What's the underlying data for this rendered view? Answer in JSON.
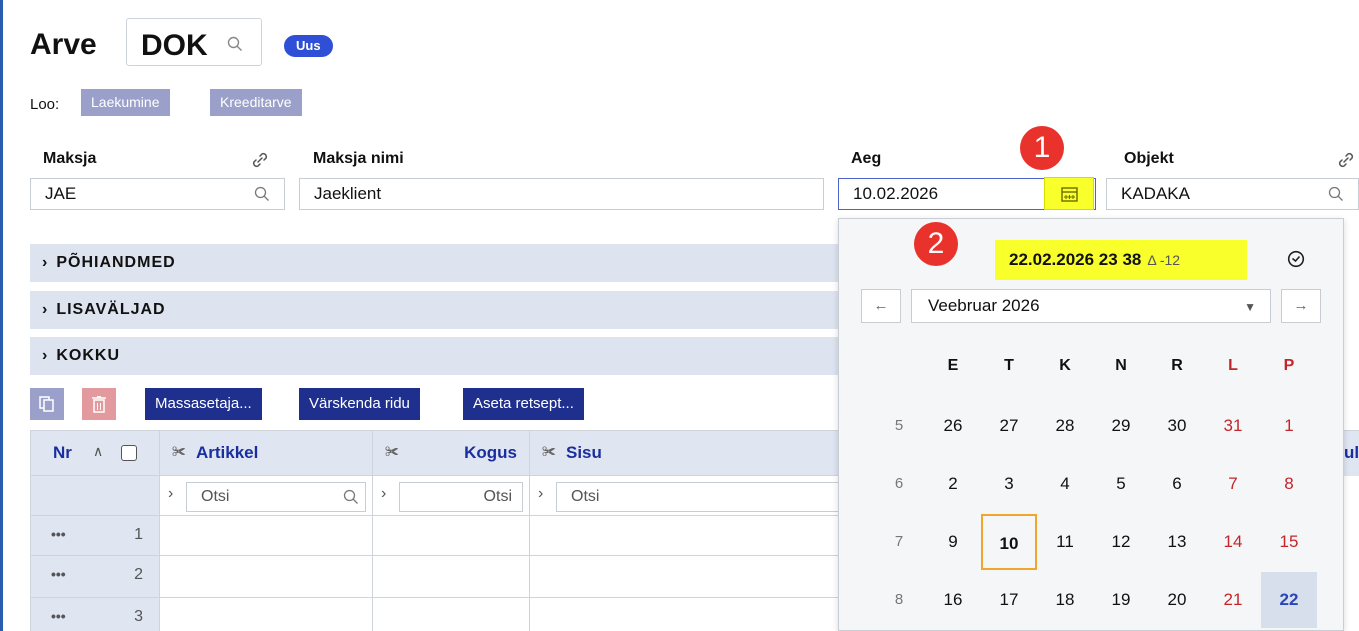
{
  "header": {
    "title": "Arve",
    "doc_code": "DOK",
    "badge": "Uus",
    "create_label": "Loo:",
    "create_buttons": [
      "Laekumine",
      "Kreeditarve"
    ]
  },
  "fields": {
    "maksja": {
      "label": "Maksja",
      "value": "JAE"
    },
    "maksja_nimi": {
      "label": "Maksja nimi",
      "value": "Jaeklient"
    },
    "aeg": {
      "label": "Aeg",
      "value": "10.02.2026"
    },
    "objekt": {
      "label": "Objekt",
      "value": "KADAKA"
    }
  },
  "callouts": [
    "1",
    "2"
  ],
  "sections": [
    "PÕHIANDMED",
    "LISAVÄLJAD",
    "KOKKU"
  ],
  "toolbar": {
    "buttons": [
      "Massasetaja...",
      "Värskenda ridu",
      "Aseta retsept..."
    ]
  },
  "grid": {
    "columns": {
      "nr": "Nr",
      "artikkel": "Artikkel",
      "kogus": "Kogus",
      "sisu": "Sisu"
    },
    "filter_placeholder": "Otsi",
    "rows": [
      "1",
      "2",
      "3"
    ],
    "row_menu": "•••"
  },
  "calendar": {
    "now": "22.02.2026 23 38",
    "delta": "Δ -12",
    "prev": "←",
    "next": "→",
    "month": "Veebruar 2026",
    "weekdays": [
      "E",
      "T",
      "K",
      "N",
      "R",
      "L",
      "P"
    ],
    "weeks": [
      {
        "week": "5",
        "days": [
          "26",
          "27",
          "28",
          "29",
          "30",
          "31",
          "1"
        ]
      },
      {
        "week": "6",
        "days": [
          "2",
          "3",
          "4",
          "5",
          "6",
          "7",
          "8"
        ]
      },
      {
        "week": "7",
        "days": [
          "9",
          "10",
          "11",
          "12",
          "13",
          "14",
          "15"
        ]
      },
      {
        "week": "8",
        "days": [
          "16",
          "17",
          "18",
          "19",
          "20",
          "21",
          "22"
        ]
      }
    ],
    "today": "10",
    "selected": "22"
  },
  "colors": {
    "accent": "#2f50d6",
    "highlight": "#f9ff2b",
    "callout": "#e8322b",
    "weekend": "#c4252b"
  }
}
